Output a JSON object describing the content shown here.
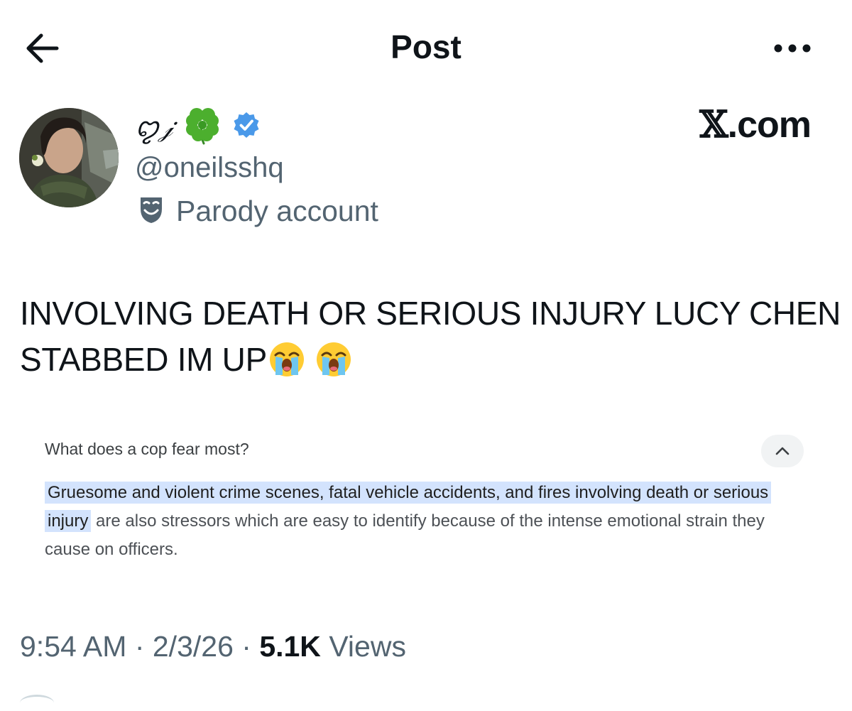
{
  "header": {
    "title": "Post",
    "back_icon": "arrow-left-icon",
    "more_icon": "more-horizontal-icon"
  },
  "author": {
    "display_name": "ꨄ𝒿",
    "clover": "☘️",
    "verified_color": "#4a99e9",
    "handle": "@oneilsshq",
    "label": "Parody account",
    "label_icon": "theater-mask-icon"
  },
  "watermark": {
    "x_mark": "𝕏",
    "domain": ".com"
  },
  "post": {
    "text": "INVOLVING DEATH OR SERIOUS INJURY LUCY CHEN STABBED IM UP",
    "emoji_1": "😭",
    "emoji_2": "😭"
  },
  "embedded_snippet": {
    "question": "What does a cop fear most?",
    "highlighted": "Gruesome and violent crime scenes, fatal vehicle accidents, and fires involving death or serious injury",
    "rest": " are also stressors which are easy to identify because of the intense emotional strain they cause on officers.",
    "highlight_color": "#d3e3fd"
  },
  "meta": {
    "time": "9:54 AM",
    "sep1": " · ",
    "date": "2/3/26",
    "sep2": " · ",
    "views_count": "5.1K",
    "views_label": " Views"
  }
}
